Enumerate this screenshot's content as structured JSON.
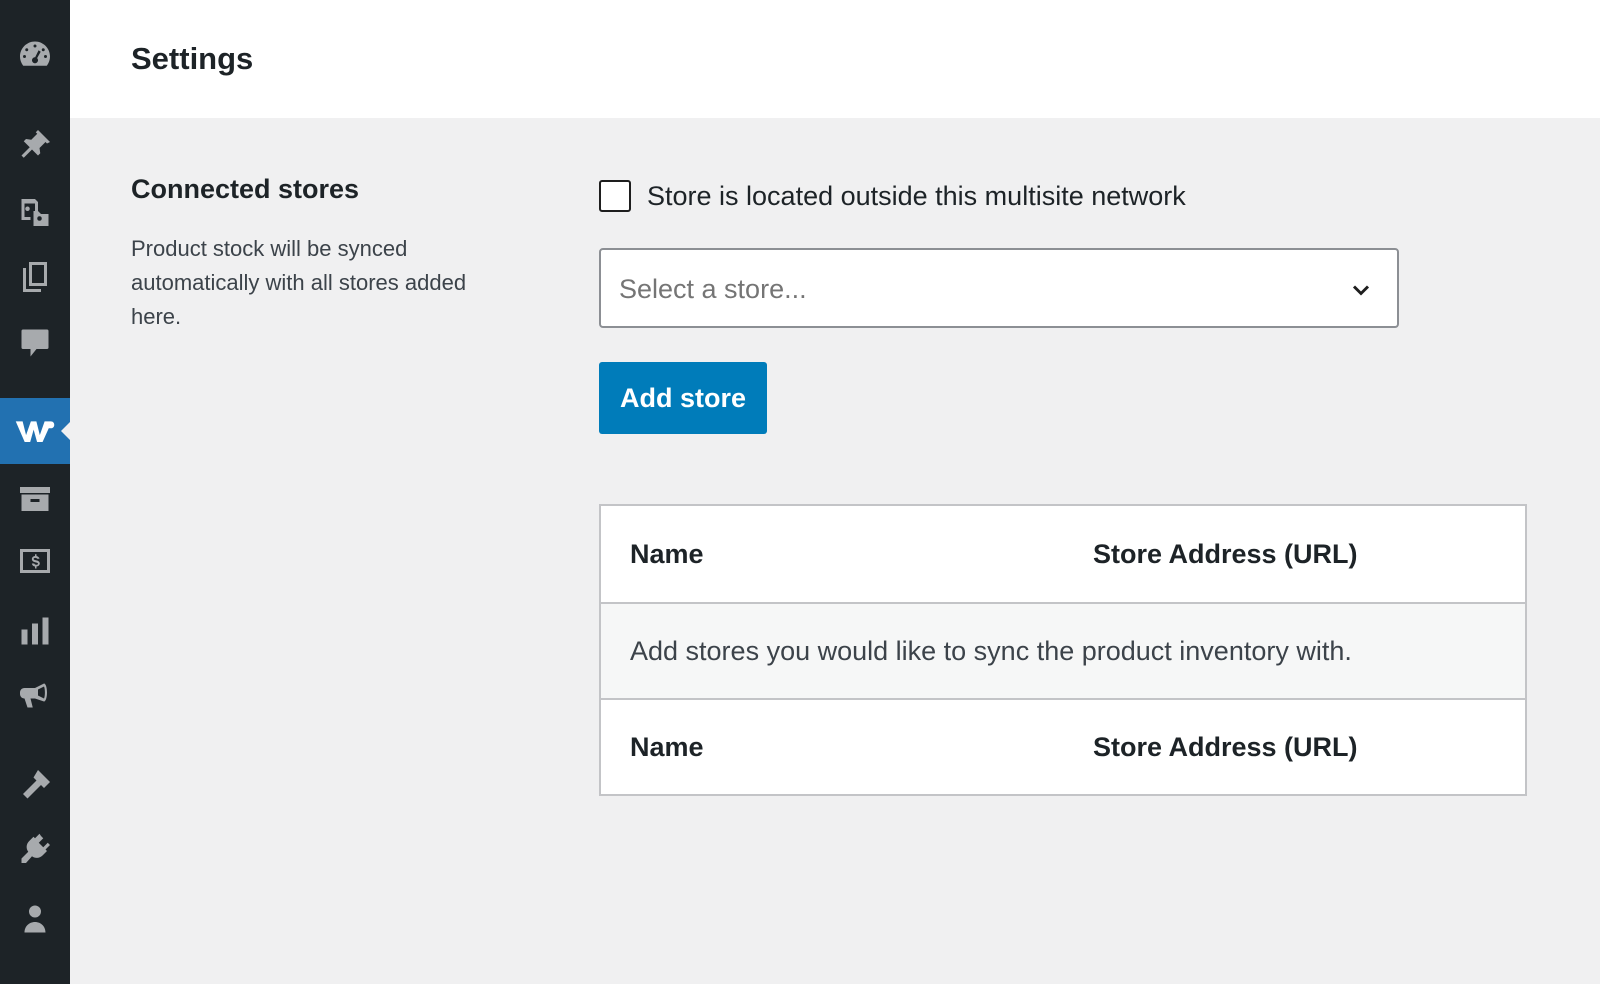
{
  "header": {
    "title": "Settings"
  },
  "sidebar": {
    "items": [
      {
        "icon": "dashboard-icon",
        "active": false
      },
      {
        "icon": "pin-icon",
        "active": false
      },
      {
        "icon": "media-icon",
        "active": false
      },
      {
        "icon": "pages-icon",
        "active": false
      },
      {
        "icon": "comments-icon",
        "active": false
      },
      {
        "icon": "woo-w-icon",
        "active": true
      },
      {
        "icon": "archive-icon",
        "active": false
      },
      {
        "icon": "payments-icon",
        "active": false
      },
      {
        "icon": "analytics-icon",
        "active": false
      },
      {
        "icon": "marketing-icon",
        "active": false
      },
      {
        "icon": "appearance-icon",
        "active": false
      },
      {
        "icon": "plugins-icon",
        "active": false
      },
      {
        "icon": "users-icon",
        "active": false
      }
    ]
  },
  "section": {
    "title": "Connected stores",
    "description": "Product stock will be synced automatically with all stores added here."
  },
  "form": {
    "checkbox_label": "Store is located outside this multisite network",
    "checkbox_checked": false,
    "select_placeholder": "Select a store...",
    "add_button": "Add store"
  },
  "table": {
    "columns": [
      "Name",
      "Store Address (URL)"
    ],
    "empty_message": "Add stores you would like to sync the product inventory with.",
    "footer_columns": [
      "Name",
      "Store Address (URL)"
    ]
  },
  "colors": {
    "sidebar_bg": "#1d2327",
    "active_item": "#2271b1",
    "primary_button": "#007cba",
    "page_bg": "#f0f0f1"
  }
}
